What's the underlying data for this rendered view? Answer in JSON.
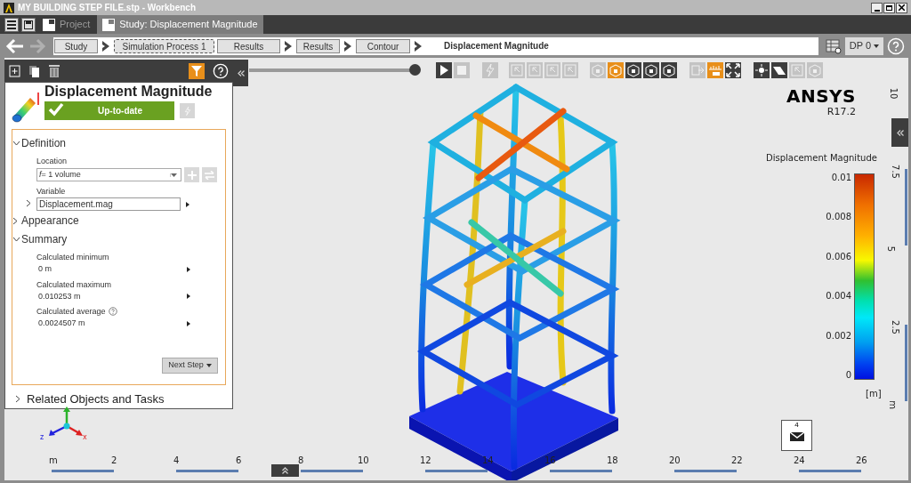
{
  "window": {
    "title": "MY BUILDING STEP FILE.stp - Workbench"
  },
  "tabs": [
    {
      "label": "Project",
      "selected": false
    },
    {
      "label": "Study: Displacement Magnitude",
      "selected": true
    }
  ],
  "breadcrumbs": [
    {
      "label": "Study",
      "focused": false
    },
    {
      "label": "Simulation Process 1",
      "focused": true
    },
    {
      "label": "Results",
      "focused": false
    },
    {
      "label": "Results",
      "focused": false
    },
    {
      "label": "Contour",
      "focused": false
    }
  ],
  "breadcrumb_current": "Displacement Magnitude",
  "design_point": "DP 0",
  "toolbar": [
    {
      "kind": "play",
      "active": false,
      "disabled": false
    },
    {
      "kind": "stop",
      "active": false,
      "disabled": true
    },
    {
      "kind": "bolt",
      "active": false,
      "disabled": true
    },
    {
      "kind": "select",
      "active": false,
      "disabled": true
    },
    {
      "kind": "select",
      "active": false,
      "disabled": true
    },
    {
      "kind": "select",
      "active": false,
      "disabled": true
    },
    {
      "kind": "select",
      "active": false,
      "disabled": true
    },
    {
      "kind": "cube",
      "active": false,
      "disabled": true
    },
    {
      "kind": "cube",
      "active": true,
      "disabled": false
    },
    {
      "kind": "cube",
      "active": false,
      "disabled": false
    },
    {
      "kind": "cube",
      "active": false,
      "disabled": false
    },
    {
      "kind": "cube",
      "active": false,
      "disabled": false
    },
    {
      "kind": "export",
      "active": false,
      "disabled": true
    },
    {
      "kind": "chart",
      "active": true,
      "disabled": false
    },
    {
      "kind": "expand",
      "active": false,
      "disabled": false
    },
    {
      "kind": "light",
      "active": false,
      "disabled": false
    },
    {
      "kind": "plane",
      "active": false,
      "disabled": false
    },
    {
      "kind": "select",
      "active": false,
      "disabled": true
    },
    {
      "kind": "cube",
      "active": false,
      "disabled": true
    }
  ],
  "triad_axes": [
    "z",
    "x"
  ],
  "panel": {
    "title": "Displacement Magnitude",
    "status": "Up-to-date",
    "sections": [
      {
        "label": "Definition",
        "expanded": true,
        "fields": [
          {
            "label": "Location",
            "kind": "dropdown",
            "value": "*f*= 1 volume",
            "help": false
          },
          {
            "label": "Variable",
            "kind": "input",
            "value": "Displacement.mag",
            "help": false
          }
        ]
      },
      {
        "label": "Appearance",
        "expanded": false
      },
      {
        "label": "Summary",
        "expanded": true,
        "fields": [
          {
            "label": "Calculated minimum",
            "kind": "readout",
            "value": "0 m",
            "help": false
          },
          {
            "label": "Calculated maximum",
            "kind": "readout",
            "value": "0.010253 m",
            "help": false
          },
          {
            "label": "Calculated average",
            "kind": "readout",
            "value": "0.0024507 m",
            "help": true
          }
        ]
      }
    ],
    "next_button": "Next Step",
    "related": "Related Objects and Tasks"
  },
  "logo": {
    "name": "ANSYS",
    "version": "R17.2"
  },
  "legend": {
    "title": "Displacement Magnitude",
    "ticks": [
      "0.01",
      "0.008",
      "0.006",
      "0.004",
      "0.002",
      "0"
    ],
    "unit": "[m]"
  },
  "vertical_ruler": [
    "10",
    "7.5",
    "5",
    "2.5",
    "m"
  ],
  "horizontal_ruler": [
    "m",
    "2",
    "4",
    "6",
    "8",
    "10",
    "12",
    "14",
    "16",
    "18",
    "20",
    "22",
    "24",
    "26"
  ],
  "view_badge": "4"
}
